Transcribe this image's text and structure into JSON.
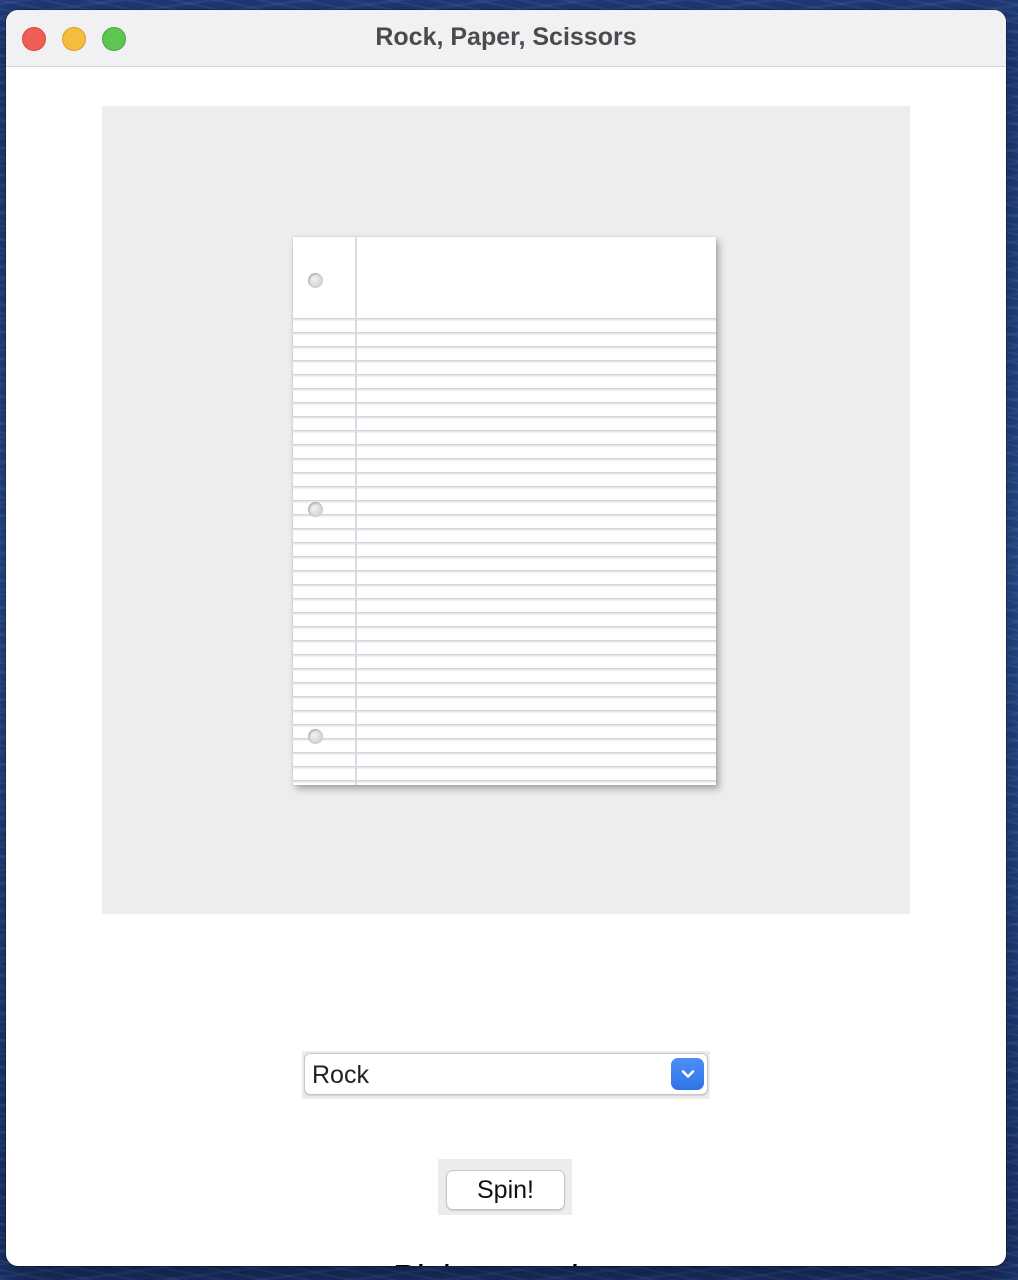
{
  "window": {
    "title": "Rock, Paper, Scissors"
  },
  "image_panel": {
    "shown": "paper-icon"
  },
  "choice_select": {
    "selected": "Rock",
    "icon": "chevron-down-icon"
  },
  "spin_button": {
    "label": "Spin!"
  },
  "status": {
    "text": "Pick an option"
  },
  "colors": {
    "select_arrow": "#2f73e8",
    "close": "#ee5e57",
    "minimize": "#f5bd3b",
    "maximize": "#5fc552"
  }
}
